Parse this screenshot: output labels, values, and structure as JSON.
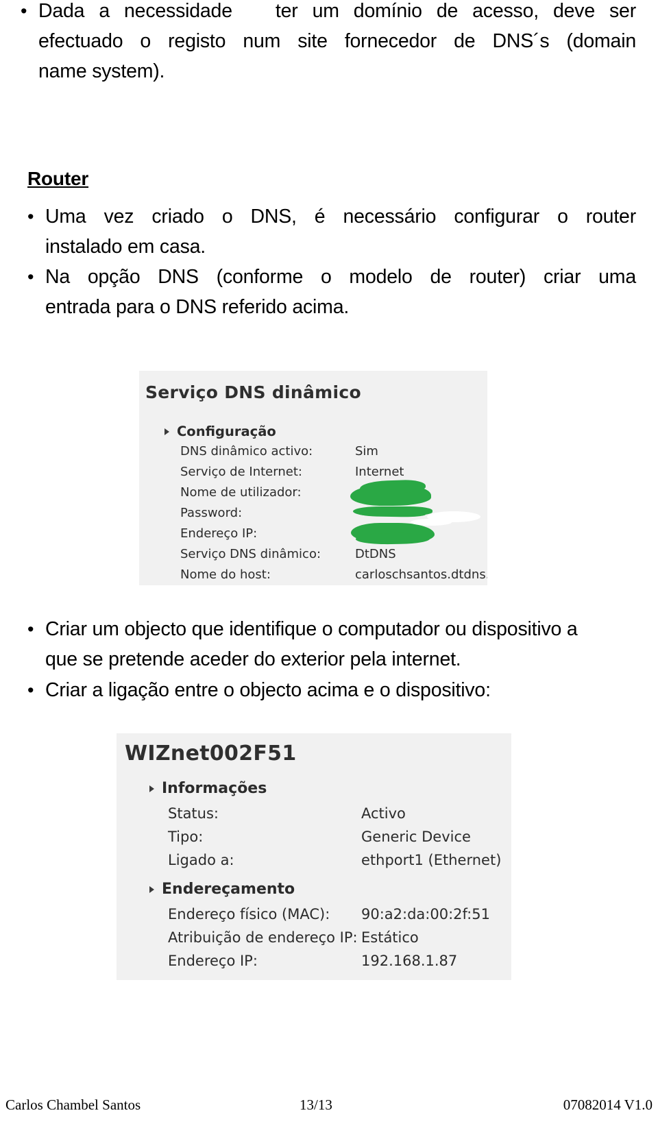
{
  "document": {
    "bullets_top": [
      {
        "lines": [
          "Dada a necessidade   ter um domínio de acesso, deve ser",
          "efectuado o registo num site fornecedor de DNS´s (domain",
          "name system)."
        ]
      }
    ],
    "router_heading": "Router",
    "bullets_router": [
      {
        "lines": [
          "Uma vez criado o DNS, é necessário configurar o router",
          "instalado em casa."
        ]
      },
      {
        "lines": [
          "Na opção DNS (conforme o modelo de router) criar uma",
          "entrada para o DNS referido acima."
        ]
      }
    ],
    "bullets_mid": [
      {
        "lines": [
          "Criar um objecto que identifique o computador ou dispositivo a",
          "que se pretende aceder do exterior pela internet."
        ]
      },
      {
        "lines": [
          "Criar a ligação entre o objecto acima e o dispositivo:"
        ]
      }
    ]
  },
  "dns_panel": {
    "title": "Serviço DNS dinâmico",
    "group_label": "Configuração",
    "rows": [
      {
        "label": "DNS dinâmico activo:",
        "value": "Sim",
        "redacted": false
      },
      {
        "label": "Serviço de Internet:",
        "value": "Internet",
        "redacted": false
      },
      {
        "label": "Nome de utilizador:",
        "value": "",
        "redacted": true
      },
      {
        "label": "Password:",
        "value": "",
        "redacted": true
      },
      {
        "label": "Endereço IP:",
        "value": "",
        "redacted": true
      },
      {
        "label": "Serviço DNS dinâmico:",
        "value": "DtDNS",
        "redacted": false
      },
      {
        "label": "Nome do host:",
        "value": "carloschsantos.dtdns.net",
        "redacted": false
      }
    ],
    "redaction_color": "#2aa845",
    "background_color": "#f1f1f1"
  },
  "device_panel": {
    "title": "WIZnet002F51",
    "groups": [
      {
        "label": "Informações",
        "rows": [
          {
            "label": "Status:",
            "value": "Activo"
          },
          {
            "label": "Tipo:",
            "value": "Generic Device"
          },
          {
            "label": "Ligado a:",
            "value": "ethport1 (Ethernet)"
          }
        ]
      },
      {
        "label": "Endereçamento",
        "rows": [
          {
            "label": "Endereço físico (MAC):",
            "value": "90:a2:da:00:2f:51"
          },
          {
            "label": "Atribuição de endereço IP:",
            "value": "Estático"
          },
          {
            "label": "Endereço IP:",
            "value": "192.168.1.87"
          }
        ]
      }
    ],
    "background_color": "#f1f1f1"
  },
  "footer": {
    "author": "Carlos Chambel Santos",
    "page": "13/13",
    "version": "07082014 V1.0"
  }
}
